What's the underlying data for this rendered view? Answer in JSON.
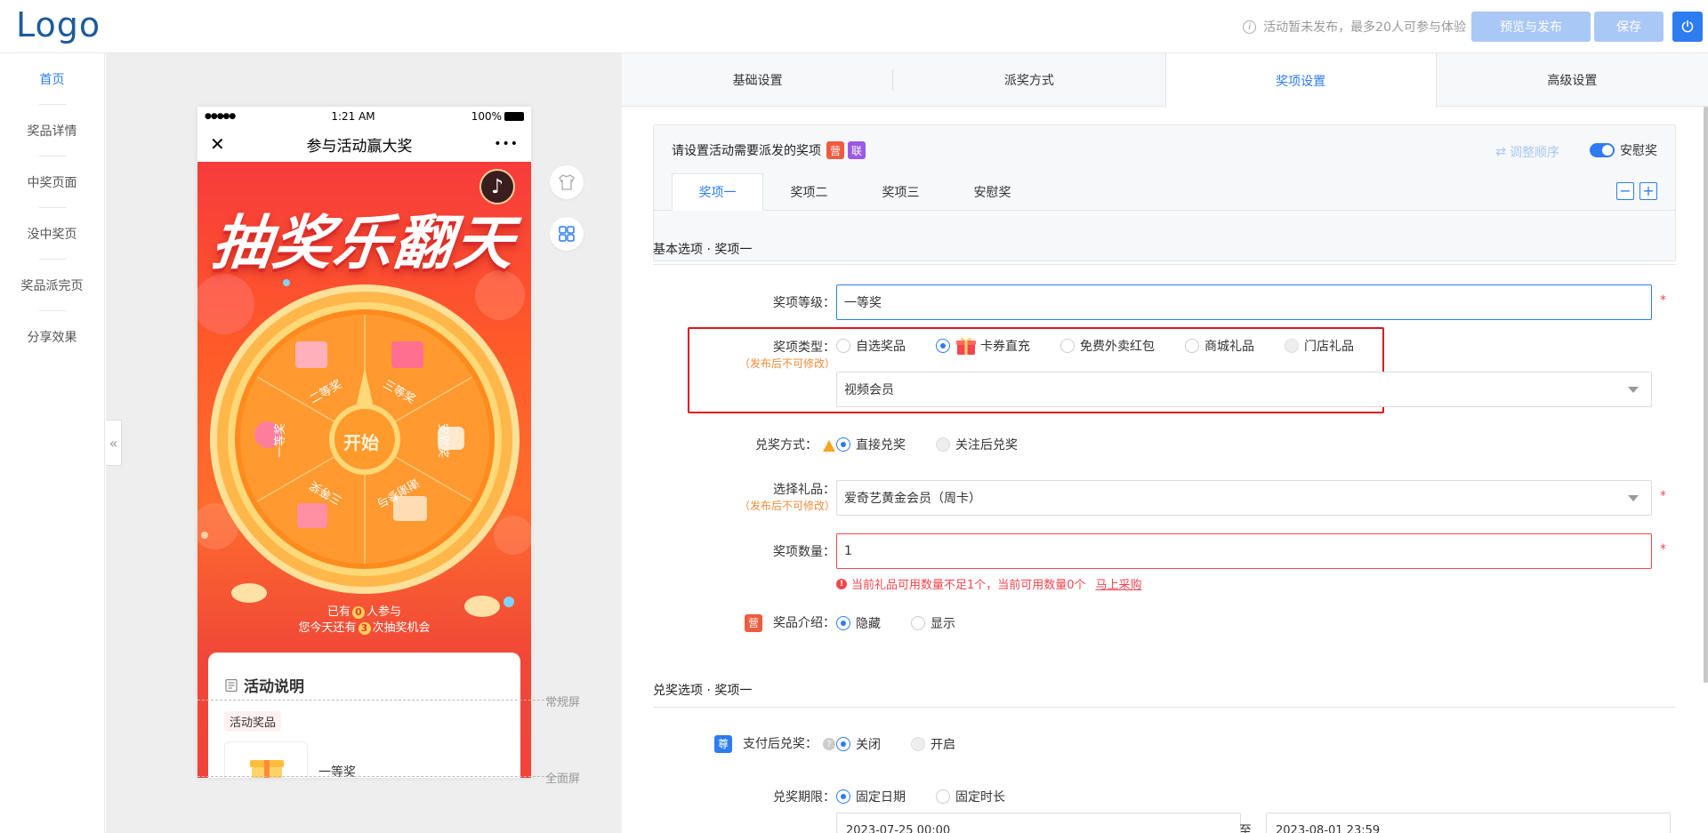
{
  "header": {
    "logo": "Logo",
    "info_text": "活动暂未发布，最多20人可参与体验",
    "info_icon": "info-icon",
    "preview_publish_label": "预览与发布",
    "save_label": "保存",
    "power_icon": "power-icon",
    "accent": "#2d7cf0"
  },
  "sidebar": {
    "items": [
      {
        "label": "首页",
        "active": true
      },
      {
        "label": "奖品详情"
      },
      {
        "label": "中奖页面"
      },
      {
        "label": "没中奖页"
      },
      {
        "label": "奖品派完页"
      },
      {
        "label": "分享效果"
      }
    ]
  },
  "preview": {
    "collapse_icon": "«",
    "status": {
      "signal": "●●●●●",
      "time": "1:21 AM",
      "battery": "100%"
    },
    "nav_title": "参与活动赢大奖",
    "close_icon": "✕",
    "more_icon": "•••",
    "poster_title": "抽奖乐翻天",
    "wheel": {
      "center_label": "开始",
      "segments": [
        "三等奖",
        "安慰奖",
        "谢谢参与",
        "三等奖",
        "一等奖",
        "二等奖"
      ]
    },
    "participants_prefix": "已有",
    "participants_count": "0",
    "participants_suffix": "人参与",
    "chances_prefix": "您今天还有",
    "chances_count": "3",
    "chances_suffix": "次抽奖机会",
    "card_title": "活动说明",
    "card_tag": "活动奖品",
    "prize_name": "一等奖",
    "normal_screen_label": "常规屏",
    "full_screen_label": "全面屏"
  },
  "main": {
    "tabs": [
      "基础设置",
      "派奖方式",
      "奖项设置",
      "高级设置"
    ],
    "active_tab": 2,
    "prize_box": {
      "title": "请设置活动需要派发的奖项",
      "badge_ying": "营",
      "badge_lian": "联",
      "reorder_label": "调整顺序",
      "consolation_label": "安慰奖",
      "sub_tabs": [
        "奖项一",
        "奖项二",
        "奖项三",
        "安慰奖"
      ],
      "minus": "−",
      "plus": "+"
    },
    "basic_section_title": "基本选项 · 奖项一",
    "level": {
      "label": "奖项等级：",
      "value": "一等奖"
    },
    "type": {
      "label": "奖项类型：",
      "note": "（发布后不可修改）",
      "options": [
        "自选奖品",
        "卡券直充",
        "免费外卖红包",
        "商城礼品",
        "门店礼品"
      ],
      "selected": "卡券直充",
      "sub_value": "视频会员"
    },
    "redeem": {
      "label": "兑奖方式：",
      "options": [
        "直接兑奖",
        "关注后兑奖"
      ]
    },
    "gift": {
      "label": "选择礼品：",
      "note": "（发布后不可修改）",
      "value": "爱奇艺黄金会员（周卡）"
    },
    "quantity": {
      "label": "奖项数量：",
      "value": "1",
      "error": "当前礼品可用数量不足1个，当前可用数量0个",
      "error_link": "马上采购"
    },
    "intro": {
      "badge": "营",
      "label": "奖品介绍：",
      "options": [
        "隐藏",
        "显示"
      ]
    },
    "redeem_section_title": "兑奖选项 · 奖项一",
    "pay_redeem": {
      "badge": "尊",
      "label": "支付后兑奖：",
      "options": [
        "关闭",
        "开启"
      ]
    },
    "period": {
      "label": "兑奖期限：",
      "options": [
        "固定日期",
        "固定时长"
      ],
      "start": "2023-07-25 00:00",
      "to": "至",
      "end": "2023-08-01 23:59"
    },
    "required_mark": "*",
    "error_red": "#f5454e",
    "note_orange": "#f08b3a",
    "highlight_red": "#e0131f"
  }
}
